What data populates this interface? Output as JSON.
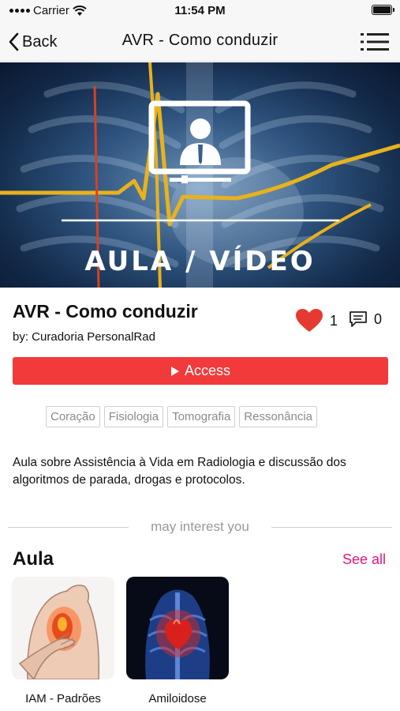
{
  "status_bar": {
    "carrier": "Carrier",
    "time": "11:54 PM"
  },
  "nav": {
    "back_label": "Back",
    "title": "AVR - Como conduzir"
  },
  "hero": {
    "caption": "AULA / VÍDEO"
  },
  "course": {
    "title": "AVR - Como conduzir",
    "author": "by: Curadoria PersonalRad",
    "likes": "1",
    "comments": "0",
    "access_label": "Access",
    "tags": [
      "Coração",
      "Fisiologia",
      "Tomografia",
      "Ressonância"
    ],
    "description": "Aula sobre Assistência à Vida em Radiologia e discussão dos algoritmos de parada, drogas e protocolos."
  },
  "related": {
    "divider": "may interest you",
    "section_title": "Aula",
    "see_all": "See all",
    "items": [
      {
        "label": "IAM - Padrões"
      },
      {
        "label": "Amiloidose"
      }
    ]
  },
  "colors": {
    "accent": "#f23a3a",
    "link": "#e6177d",
    "heart": "#e53a32"
  },
  "icons": [
    "wifi-icon",
    "battery-icon",
    "chevron-left-icon",
    "list-menu-icon",
    "heart-icon",
    "comment-icon",
    "play-icon"
  ]
}
